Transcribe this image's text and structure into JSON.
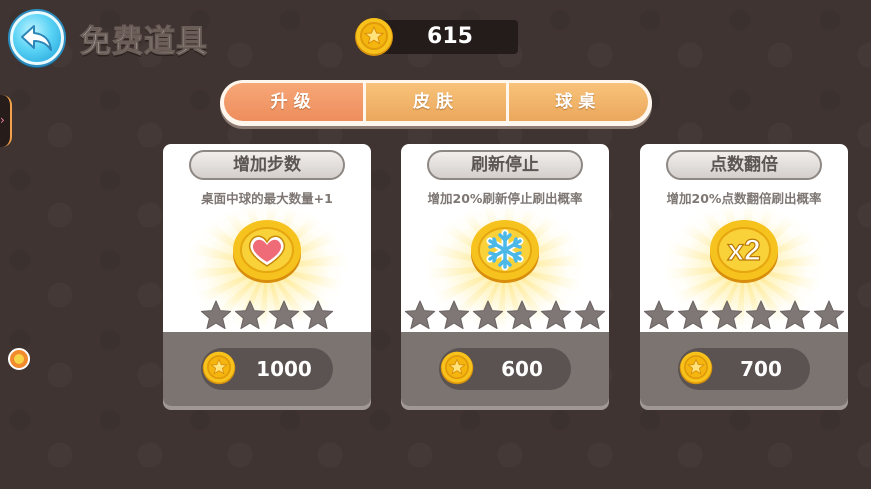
{
  "header": {
    "title": "免费道具",
    "coin_balance": "615"
  },
  "tabs": [
    {
      "label": "升级",
      "active": true
    },
    {
      "label": "皮肤",
      "active": false
    },
    {
      "label": "球桌",
      "active": false
    }
  ],
  "cards": [
    {
      "title": "增加步数",
      "description": "桌面中球的最大数量+1",
      "icon": "heart-icon",
      "stars_filled": 0,
      "stars_total": 4,
      "price": "1000"
    },
    {
      "title": "刷新停止",
      "description": "增加20%刷新停止刷出概率",
      "icon": "snowflake-icon",
      "stars_filled": 0,
      "stars_total": 6,
      "price": "600"
    },
    {
      "title": "点数翻倍",
      "description": "增加20%点数翻倍刷出概率",
      "icon": "x2-icon",
      "icon_text": "x2",
      "stars_filled": 0,
      "stars_total": 6,
      "price": "700"
    }
  ],
  "colors": {
    "background": "#3f3431",
    "tab_active": "#ee8d5d",
    "tab_inactive": "#eaa75c",
    "coin_gold": "#f7c21c",
    "star_empty": "#7e7775"
  }
}
